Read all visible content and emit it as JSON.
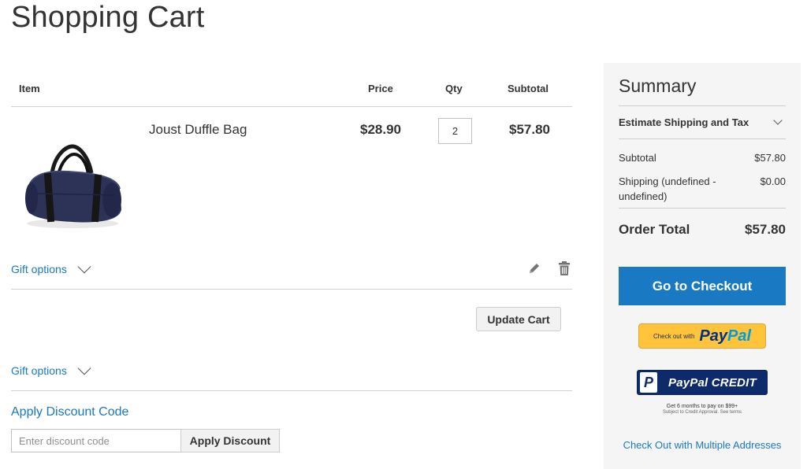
{
  "page": {
    "title": "Shopping Cart"
  },
  "cart": {
    "headers": {
      "item": "Item",
      "price": "Price",
      "qty": "Qty",
      "subtotal": "Subtotal"
    },
    "items": [
      {
        "name": "Joust Duffle Bag",
        "price": "$28.90",
        "qty": "2",
        "subtotal": "$57.80"
      }
    ],
    "gift_options_label": "Gift options",
    "update_cart_label": "Update Cart",
    "gift_options_cart_label": "Gift options"
  },
  "discount": {
    "title": "Apply Discount Code",
    "placeholder": "Enter discount code",
    "apply_label": "Apply Discount"
  },
  "summary": {
    "title": "Summary",
    "estimate_label": "Estimate Shipping and Tax",
    "subtotal_label": "Subtotal",
    "subtotal_value": "$57.80",
    "shipping_label": "Shipping (undefined - undefined)",
    "shipping_value": "$0.00",
    "order_total_label": "Order Total",
    "order_total_value": "$57.80",
    "checkout_label": "Go to Checkout",
    "paypal": {
      "small_text": "Check out with",
      "logo_pay": "Pay",
      "logo_pal": "Pal"
    },
    "paypal_credit": {
      "mark": "P",
      "label": "PayPal CREDIT",
      "note_line1": "Get 6 months to pay on $99+",
      "note_line2": "Subject to Credit Approval. See terms"
    },
    "multi_address_label": "Check Out with Multiple Addresses"
  },
  "colors": {
    "link": "#1979c3",
    "checkout_bg": "#1979c3",
    "paypal_yellow": "#ffc439",
    "paypal_credit_navy": "#0d2b6b",
    "summary_bg": "#f5f5f5"
  },
  "icons": {
    "edit": "pencil-icon",
    "delete": "trash-icon",
    "expand": "chevron-down-icon"
  }
}
